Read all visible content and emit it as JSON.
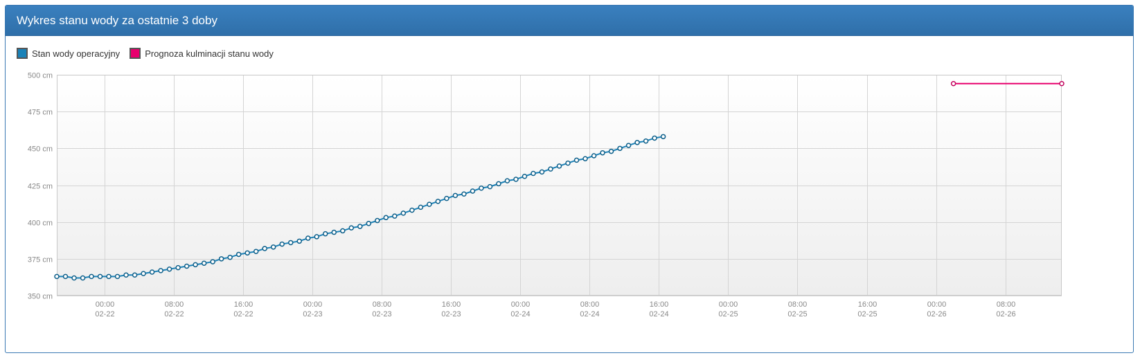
{
  "panel": {
    "title": "Wykres stanu wody za ostatnie 3 doby"
  },
  "colors": {
    "observed": "#1a82b8",
    "forecast": "#e8006e",
    "header": "#3a80bf"
  },
  "chart_data": {
    "type": "line",
    "title": "",
    "xlabel": "",
    "ylabel": "",
    "y_unit": "cm",
    "ylim": [
      350,
      500
    ],
    "y_ticks": [
      "500 cm",
      "475 cm",
      "450 cm",
      "425 cm",
      "400 cm",
      "375 cm",
      "350 cm"
    ],
    "y_tick_values": [
      500,
      475,
      450,
      425,
      400,
      375,
      350
    ],
    "x_range": [
      "02-21 18:30",
      "02-26 14:30"
    ],
    "x_ticks": [
      {
        "time": "00:00",
        "date": "02-22"
      },
      {
        "time": "08:00",
        "date": "02-22"
      },
      {
        "time": "16:00",
        "date": "02-22"
      },
      {
        "time": "00:00",
        "date": "02-23"
      },
      {
        "time": "08:00",
        "date": "02-23"
      },
      {
        "time": "16:00",
        "date": "02-23"
      },
      {
        "time": "00:00",
        "date": "02-24"
      },
      {
        "time": "08:00",
        "date": "02-24"
      },
      {
        "time": "16:00",
        "date": "02-24"
      },
      {
        "time": "00:00",
        "date": "02-25"
      },
      {
        "time": "08:00",
        "date": "02-25"
      },
      {
        "time": "16:00",
        "date": "02-25"
      },
      {
        "time": "00:00",
        "date": "02-26"
      },
      {
        "time": "08:00",
        "date": "02-26"
      }
    ],
    "grid": true,
    "legend_position": "top-left",
    "series": [
      {
        "name": "Stan wody operacyjny",
        "start": "02-21 18:30",
        "step_minutes": 60,
        "values": [
          363,
          363,
          362,
          362,
          363,
          363,
          363,
          363,
          364,
          364,
          365,
          366,
          367,
          368,
          369,
          370,
          371,
          372,
          373,
          375,
          376,
          378,
          379,
          380,
          382,
          383,
          385,
          386,
          387,
          389,
          390,
          392,
          393,
          394,
          396,
          397,
          399,
          401,
          403,
          404,
          406,
          408,
          410,
          412,
          414,
          416,
          418,
          419,
          421,
          423,
          424,
          426,
          428,
          429,
          431,
          433,
          434,
          436,
          438,
          440,
          442,
          443,
          445,
          447,
          448,
          450,
          452,
          454,
          455,
          457,
          458
        ]
      },
      {
        "name": "Prognoza kulminacji stanu wody",
        "points": [
          {
            "x": "02-26 02:00",
            "y": 494
          },
          {
            "x": "02-26 14:30",
            "y": 494
          }
        ]
      }
    ]
  }
}
